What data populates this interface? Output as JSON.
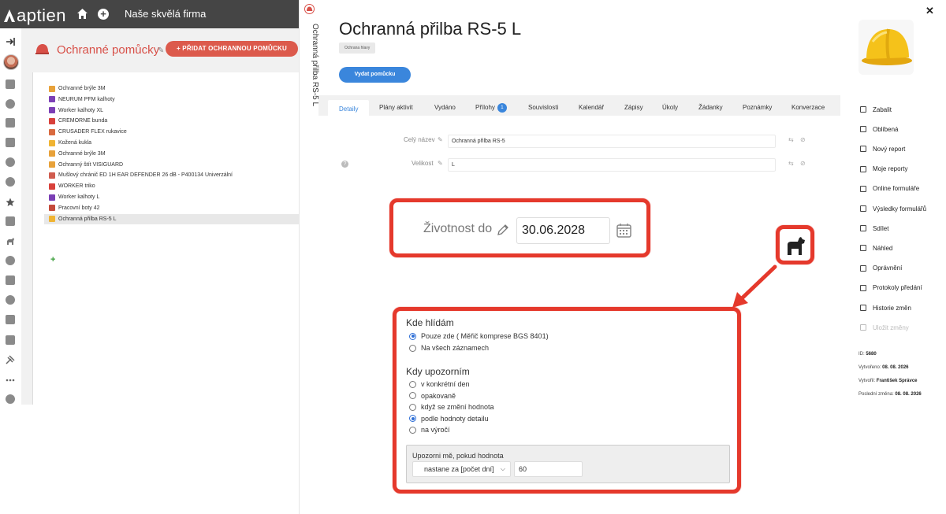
{
  "app": {
    "logo_text": "aptien",
    "company": "Naše skvělá firma"
  },
  "left_panel": {
    "title": "Ochranné pomůcky",
    "add_button": "+ PŘIDAT OCHRANNOU POMŮCKU",
    "items": [
      {
        "label": "Ochranné brýle 3M",
        "icon_color": "#e8a23a"
      },
      {
        "label": "NEURUM PFM kalhoty",
        "icon_color": "#7b3fb5"
      },
      {
        "label": "Worker kalhoty XL",
        "icon_color": "#7b3fb5"
      },
      {
        "label": "CREMORNE bunda",
        "icon_color": "#d8413b"
      },
      {
        "label": "CRUSADER FLEX rukavice",
        "icon_color": "#d96a3f"
      },
      {
        "label": "Kožená kukla",
        "icon_color": "#f0b433"
      },
      {
        "label": "Ochranné brýle 3M",
        "icon_color": "#e8a23a"
      },
      {
        "label": "Ochranný štít VISIGUARD",
        "icon_color": "#e8a23a"
      },
      {
        "label": "Mušlový chránič ED 1H EAR DEFENDER 26 dB - P400134 Univerzální",
        "icon_color": "#d05c4f"
      },
      {
        "label": "WORKER triko",
        "icon_color": "#d8413b"
      },
      {
        "label": "Worker kalhoty L",
        "icon_color": "#7b3fb5"
      },
      {
        "label": "Pracovní boty 42",
        "icon_color": "#c44a3a"
      },
      {
        "label": "Ochranná přilba RS-5 L",
        "icon_color": "#f0b433",
        "selected": true
      }
    ]
  },
  "detail": {
    "vertical_title": "Ochranná přilba RS-5 L",
    "title": "Ochranná přilba RS-5 L",
    "tag": "Ochrana hlavy",
    "issue_button": "Vydat pomůcku",
    "tabs": [
      {
        "label": "Detaily",
        "active": true
      },
      {
        "label": "Plány aktivit"
      },
      {
        "label": "Vydáno"
      },
      {
        "label": "Přílohy",
        "badge": "1"
      },
      {
        "label": "Souvislosti"
      },
      {
        "label": "Kalendář"
      },
      {
        "label": "Zápisy"
      },
      {
        "label": "Úkoly"
      },
      {
        "label": "Žádanky"
      },
      {
        "label": "Poznámky"
      },
      {
        "label": "Konverzace"
      }
    ],
    "fields": {
      "full_name_label": "Celý název",
      "full_name_value": "Ochranná přilba RS-5",
      "size_label": "Velikost",
      "size_value": "L"
    }
  },
  "actions": [
    {
      "label": "Zabalit"
    },
    {
      "label": "Oblíbená"
    },
    {
      "label": "Nový report"
    },
    {
      "label": "Moje reporty"
    },
    {
      "label": "Online formuláře"
    },
    {
      "label": "Výsledky formulářů"
    },
    {
      "label": "Sdílet"
    },
    {
      "label": "Náhled"
    },
    {
      "label": "Oprávnění"
    },
    {
      "label": "Protokoly předání"
    },
    {
      "label": "Historie změn"
    },
    {
      "label": "Uložit změny",
      "disabled": true
    }
  ],
  "meta": {
    "id_label": "ID:",
    "id_value": "5680",
    "created_label": "Vytvořeno:",
    "created_value": "08. 08. 2026",
    "author_label": "Vytvořil:",
    "author_value": "František Správce",
    "changed_label": "Poslední změna:",
    "changed_value": "08. 08. 2026"
  },
  "callout_date": {
    "label": "Životnost do",
    "value": "30.06.2028"
  },
  "callout_settings": {
    "where_heading": "Kde hlídám",
    "where_options": [
      {
        "label": "Pouze zde ( Měřič komprese BGS 8401)",
        "selected": true
      },
      {
        "label": "Na všech záznamech",
        "selected": false
      }
    ],
    "when_heading": "Kdy upozorním",
    "when_options": [
      {
        "label": "v konkrétní den",
        "selected": false
      },
      {
        "label": "opakovaně",
        "selected": false
      },
      {
        "label": "když se změní hodnota",
        "selected": false
      },
      {
        "label": "podle hodnoty detailu",
        "selected": true
      },
      {
        "label": "na výročí",
        "selected": false
      }
    ],
    "notify_label": "Upozorni mě, pokud hodnota",
    "notify_select": "nastane za [počet dní]",
    "notify_days": "60"
  },
  "colors": {
    "accent_red": "#e5392c",
    "primary_blue": "#3a86dc",
    "topbar": "#454545"
  }
}
